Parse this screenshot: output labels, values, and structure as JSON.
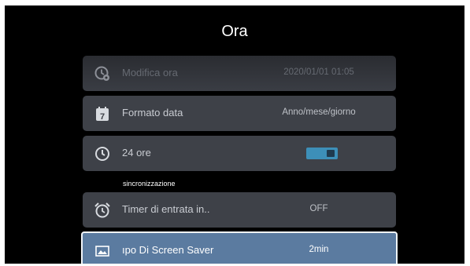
{
  "header": {
    "title": "Ora"
  },
  "rows": [
    {
      "label": "Modifica ora",
      "value": "2020/01/01 01:05",
      "icon": "clock-settings-icon"
    },
    {
      "label": "Formato data",
      "value": "Anno/mese/giorno",
      "icon": "calendar-icon"
    },
    {
      "label": "24 ore",
      "value": "on",
      "icon": "clock-icon"
    },
    {
      "label": "Timer di entrata in..",
      "value": "OFF",
      "icon": "alarm-clock-icon"
    },
    {
      "label": "ıpo Di Screen Saver",
      "value": "2min",
      "icon": "picture-icon",
      "page_dots": 3,
      "active_dot": 2
    }
  ],
  "section": {
    "label": "sincronizzazione"
  },
  "colors": {
    "screen": "#000000",
    "row": "#3e4148",
    "focused": "#5b7ba0",
    "toggle": "#3d8fb8"
  }
}
